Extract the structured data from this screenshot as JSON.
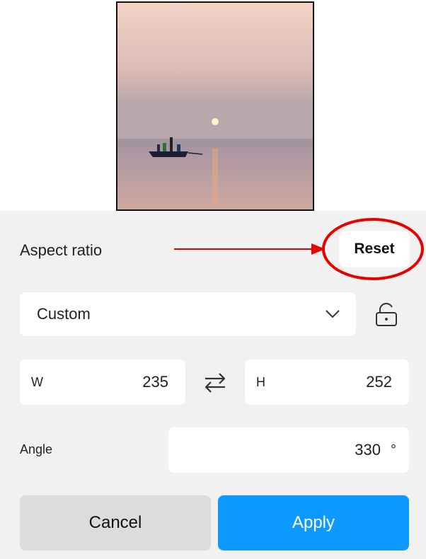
{
  "aspect": {
    "label": "Aspect ratio",
    "reset_label": "Reset"
  },
  "ratio_select": {
    "value": "Custom",
    "icon": "chevron-down-icon",
    "lock_icon": "unlock-icon"
  },
  "dimensions": {
    "w_label": "W",
    "w_value": "235",
    "h_label": "H",
    "h_value": "252",
    "swap_icon": "swap-icon"
  },
  "angle": {
    "label": "Angle",
    "value": "330",
    "unit": "°"
  },
  "actions": {
    "cancel_label": "Cancel",
    "apply_label": "Apply"
  },
  "colors": {
    "panel_bg": "#f1f1f1",
    "apply_bg": "#0d99ff",
    "annotation_red": "#e60000"
  }
}
